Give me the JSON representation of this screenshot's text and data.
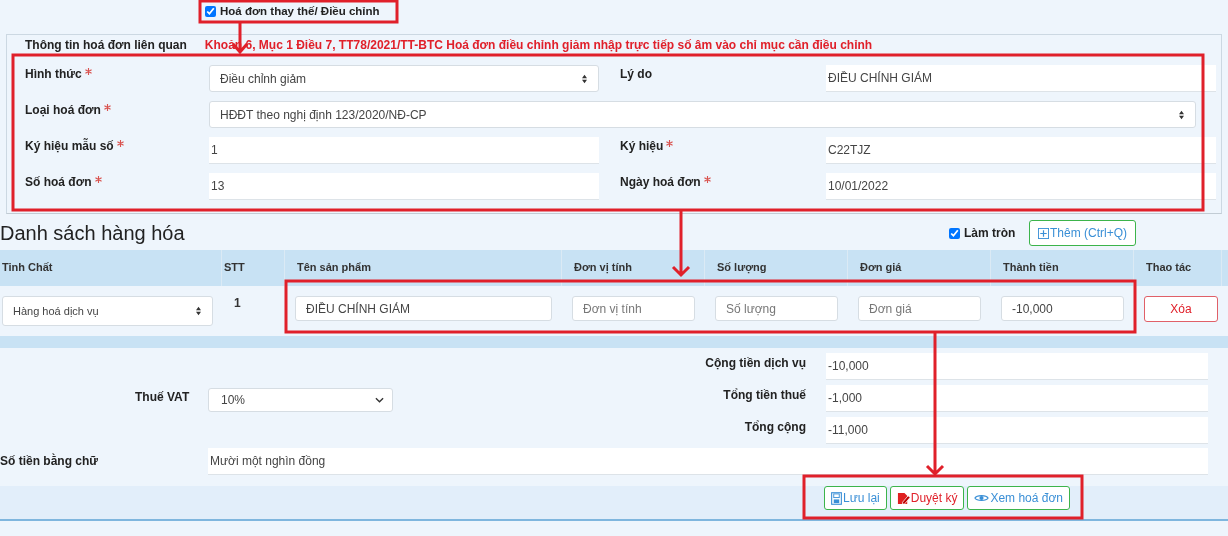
{
  "replace_toggle": {
    "label": "Hoá đơn thay thế/ Điều chỉnh",
    "checked": true
  },
  "related_invoice": {
    "title": "Thông tin hoá đơn liên quan",
    "note": "Khoản 6, Mục 1 Điều 7, TT78/2021/TT-BTC Hoá đơn điều chỉnh giảm nhập trực tiếp số âm vào chỉ mục cần điều chỉnh",
    "rows": [
      [
        {
          "label": "Hình thức",
          "required": true,
          "kind": "select",
          "value": "Điều chỉnh giảm"
        },
        {
          "label": "Lý do",
          "required": false,
          "kind": "input",
          "value": "ĐIỀU CHỈNH GIẢM"
        }
      ],
      [
        {
          "label": "Loại hoá đơn",
          "required": true,
          "kind": "select",
          "value": "HĐĐT theo nghị định 123/2020/NĐ-CP"
        }
      ],
      [
        {
          "label": "Ký hiệu mẫu số",
          "required": true,
          "kind": "input",
          "value": "1"
        },
        {
          "label": "Ký hiệu",
          "required": true,
          "kind": "input",
          "value": "C22TJZ"
        }
      ],
      [
        {
          "label": "Số hoá đơn",
          "required": true,
          "kind": "input",
          "value": "13"
        },
        {
          "label": "Ngày hoá đơn",
          "required": true,
          "kind": "input",
          "value": "10/01/2022"
        }
      ]
    ]
  },
  "goods": {
    "title": "Danh sách hàng hóa",
    "rounding": {
      "label": "Làm tròn",
      "checked": true
    },
    "add_button": "Thêm (Ctrl+Q)",
    "columns": [
      "Tinh Chất",
      "STT",
      "Tên sản phẩm",
      "Đơn vị tính",
      "Số lượng",
      "Đơn giá",
      "Thành tiền",
      "Thao tác"
    ],
    "rows": [
      [
        {
          "kind": "select",
          "value": "Hàng hoá dịch vụ"
        },
        {
          "kind": "text",
          "text": "1"
        },
        {
          "kind": "input",
          "value": "ĐIỀU CHỈNH GIẢM"
        },
        {
          "kind": "input",
          "placeholder": "Đơn vị tính"
        },
        {
          "kind": "input",
          "placeholder": "Số lượng"
        },
        {
          "kind": "input",
          "placeholder": "Đơn giá"
        },
        {
          "kind": "input",
          "value": "-10,000"
        },
        {
          "kind": "button",
          "text": "Xóa"
        }
      ]
    ]
  },
  "summary": {
    "vat": {
      "label": "Thuế VAT",
      "value": "10%"
    },
    "totals": [
      {
        "label": "Cộng tiền dịch vụ",
        "value": "-10,000"
      },
      {
        "label": "Tổng tiền thuế",
        "value": "-1,000"
      },
      {
        "label": "Tổng cộng",
        "value": "-11,000"
      }
    ],
    "amount_in_words": {
      "label": "Số tiền bằng chữ",
      "value": "Mười một nghìn đồng"
    }
  },
  "buttons": [
    {
      "kind": "save",
      "label": "Lưu lại"
    },
    {
      "kind": "approve",
      "label": "Duyệt ký"
    },
    {
      "kind": "preview",
      "label": "Xem hoá đơn"
    }
  ]
}
